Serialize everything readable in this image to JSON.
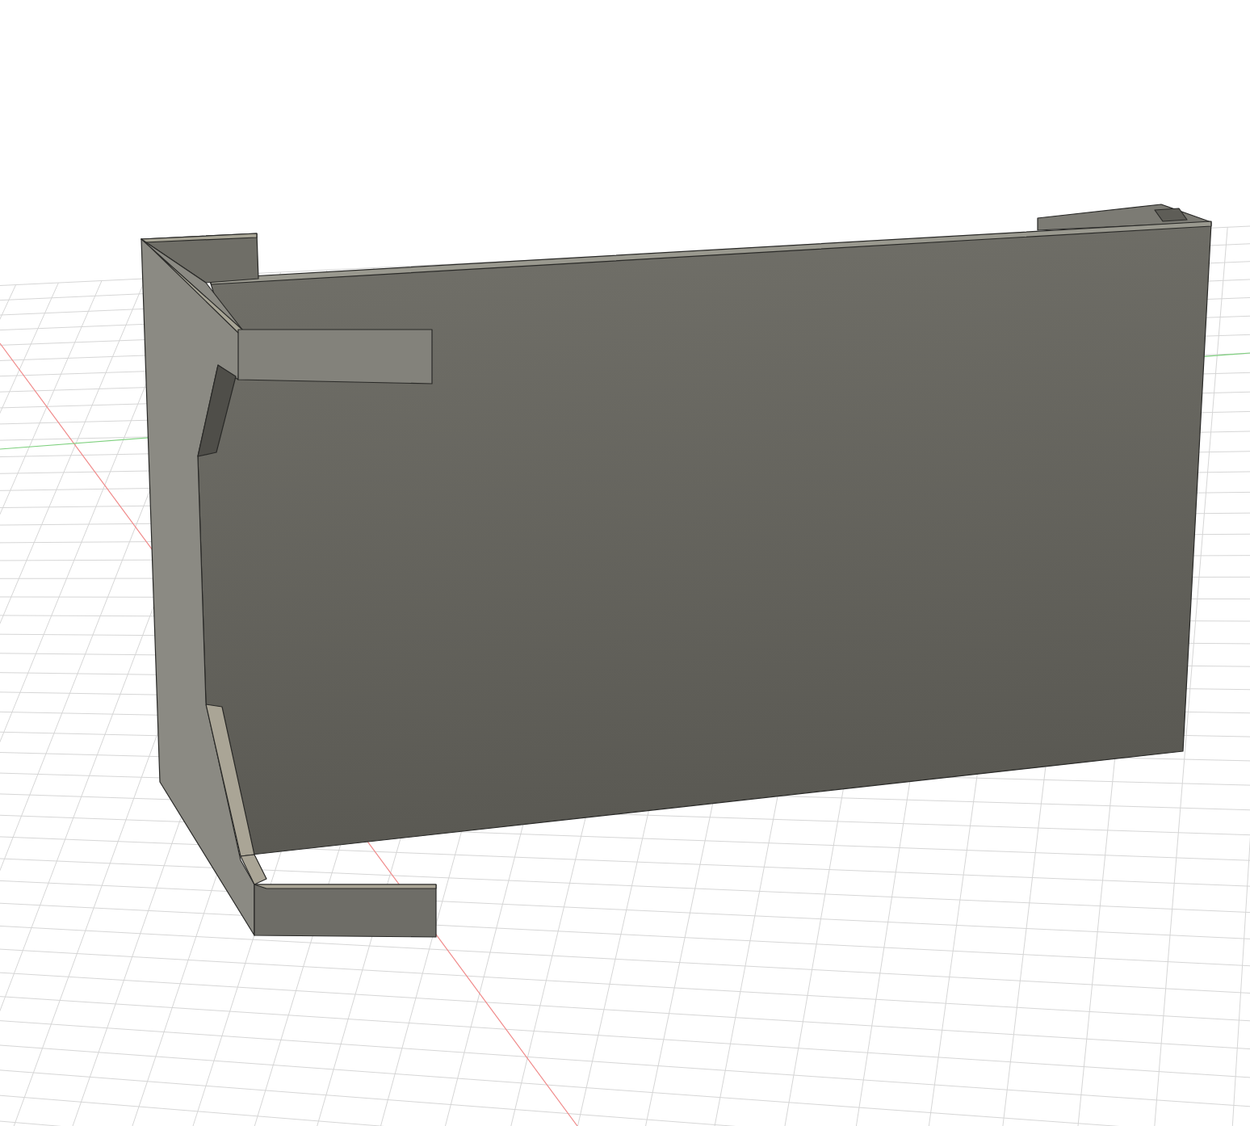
{
  "viewport": {
    "grid": {
      "visible": true
    },
    "axes": {
      "visible": true
    },
    "model": {
      "kind": "bracket"
    }
  }
}
